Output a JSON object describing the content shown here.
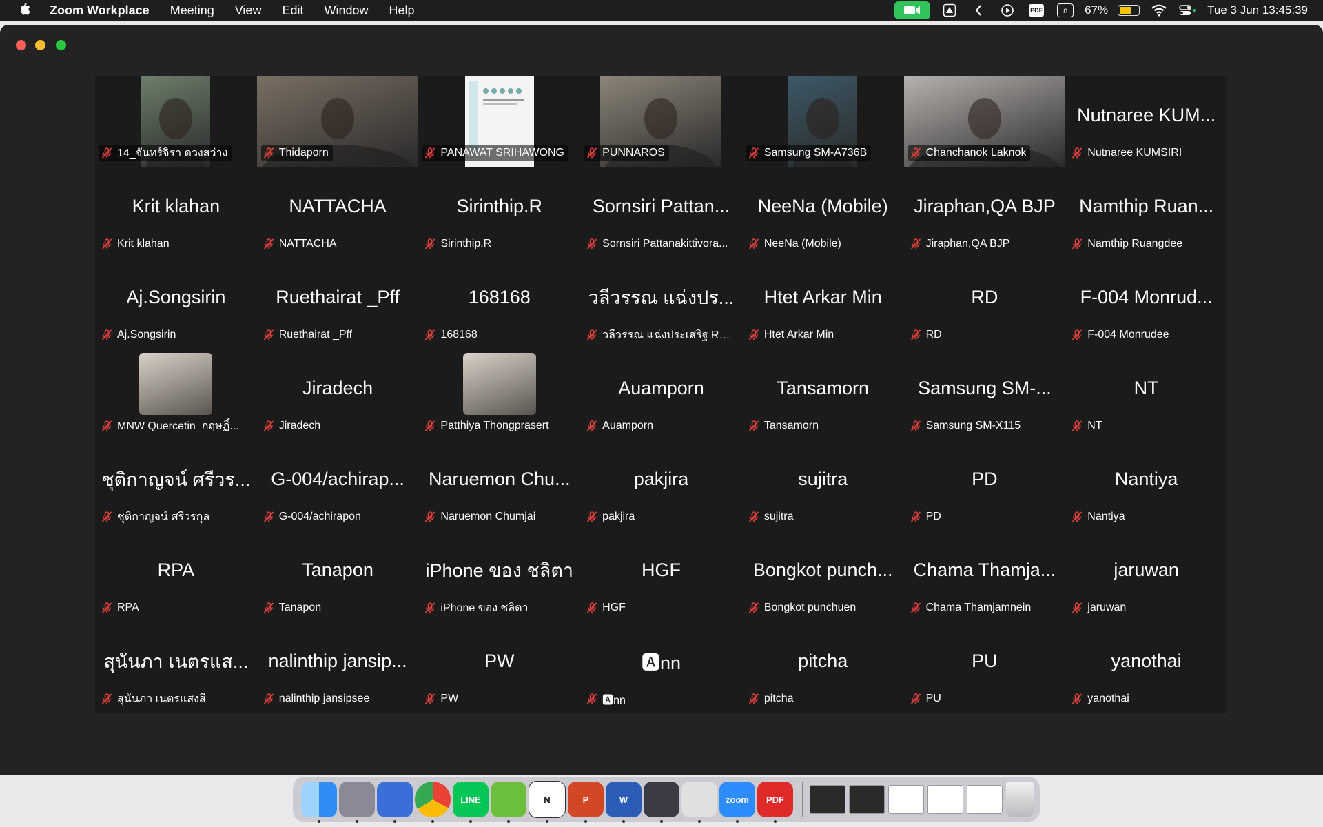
{
  "menubar": {
    "app_name": "Zoom Workplace",
    "menus": [
      "Meeting",
      "View",
      "Edit",
      "Window",
      "Help"
    ],
    "battery": "67%",
    "battery_level": 0.67,
    "datetime": "Tue 3 Jun  13:45:39",
    "status_icons": [
      "zoom-camera-icon",
      "drive-icon",
      "chevron-left-icon",
      "play-circle-icon",
      "pdf-icon",
      "thai-input-icon",
      "battery-icon",
      "wifi-icon",
      "control-center-icon"
    ]
  },
  "window": {
    "traffic_lights": {
      "close": "#ff5f57",
      "minimize": "#febc2e",
      "zoom": "#28c840"
    }
  },
  "participants": [
    {
      "display": "",
      "label": "14_จันทร์จิรา ดวงสว่าง",
      "video": "photo"
    },
    {
      "display": "",
      "label": "Thidaporn",
      "video": "photo"
    },
    {
      "display": "",
      "label": "PANAWAT SRIHAWONG",
      "video": "document"
    },
    {
      "display": "",
      "label": "PUNNAROS",
      "video": "photo"
    },
    {
      "display": "",
      "label": "Samsung SM-A736B",
      "video": "photo"
    },
    {
      "display": "",
      "label": "Chanchanok Laknok",
      "video": "photo"
    },
    {
      "display": "Nutnaree KUM...",
      "label": "Nutnaree KUMSIRI",
      "video": "none"
    },
    {
      "display": "Krit klahan",
      "label": "Krit klahan",
      "video": "none"
    },
    {
      "display": "NATTACHA",
      "label": "NATTACHA",
      "video": "none"
    },
    {
      "display": "Sirinthip.R",
      "label": "Sirinthip.R",
      "video": "none"
    },
    {
      "display": "Sornsiri Pattan...",
      "label": "Sornsiri Pattanakittivora...",
      "video": "none"
    },
    {
      "display": "NeeNa (Mobile)",
      "label": "NeeNa (Mobile)",
      "video": "none"
    },
    {
      "display": "Jiraphan,QA BJP",
      "label": "Jiraphan,QA BJP",
      "video": "none"
    },
    {
      "display": "Namthip Ruan...",
      "label": "Namthip Ruangdee",
      "video": "none"
    },
    {
      "display": "Aj.Songsirin",
      "label": "Aj.Songsirin",
      "video": "none"
    },
    {
      "display": "Ruethairat _Pff",
      "label": "Ruethairat _Pff",
      "video": "none"
    },
    {
      "display": "168168",
      "label": "168168",
      "video": "none"
    },
    {
      "display": "วลีวรรณ แฉ่งปร...",
      "label": "วลีวรรณ แฉ่งประเสริฐ RMU...",
      "video": "none"
    },
    {
      "display": "Htet Arkar Min",
      "label": "Htet Arkar Min",
      "video": "none"
    },
    {
      "display": "RD",
      "label": "RD",
      "video": "none"
    },
    {
      "display": "F-004 Monrud...",
      "label": "F-004 Monrudee",
      "video": "none"
    },
    {
      "display": "",
      "label": "MNW Quercetin_กฤษฏิ์...",
      "video": "avatar"
    },
    {
      "display": "Jiradech",
      "label": "Jiradech",
      "video": "none"
    },
    {
      "display": "",
      "label": "Patthiya Thongprasert",
      "video": "avatar"
    },
    {
      "display": "Auamporn",
      "label": "Auamporn",
      "video": "none"
    },
    {
      "display": "Tansamorn",
      "label": "Tansamorn",
      "video": "none"
    },
    {
      "display": "Samsung SM-...",
      "label": "Samsung SM-X115",
      "video": "none"
    },
    {
      "display": "NT",
      "label": "NT",
      "video": "none"
    },
    {
      "display": "ชุติกาญจน์ ศรีวร...",
      "label": "ชุติกาญจน์ ศรีวรกุล",
      "video": "none"
    },
    {
      "display": "G-004/achirap...",
      "label": "G-004/achirapon",
      "video": "none"
    },
    {
      "display": "Naruemon Chu...",
      "label": "Naruemon Chumjai",
      "video": "none"
    },
    {
      "display": "pakjira",
      "label": "pakjira",
      "video": "none"
    },
    {
      "display": "sujitra",
      "label": "sujitra",
      "video": "none"
    },
    {
      "display": "PD",
      "label": "PD",
      "video": "none"
    },
    {
      "display": "Nantiya",
      "label": "Nantiya",
      "video": "none"
    },
    {
      "display": "RPA",
      "label": "RPA",
      "video": "none"
    },
    {
      "display": "Tanapon",
      "label": "Tanapon",
      "video": "none"
    },
    {
      "display": "iPhone ของ ชลิตา",
      "label": "iPhone ของ ชลิตา",
      "video": "none"
    },
    {
      "display": "HGF",
      "label": "HGF",
      "video": "none"
    },
    {
      "display": "Bongkot punch...",
      "label": "Bongkot punchuen",
      "video": "none"
    },
    {
      "display": "Chama Thamja...",
      "label": "Chama Thamjamnein",
      "video": "none"
    },
    {
      "display": "jaruwan",
      "label": "jaruwan",
      "video": "none"
    },
    {
      "display": "สุนันภา เนตรแส...",
      "label": "สุนันภา เนตรแสงสี",
      "video": "none"
    },
    {
      "display": "nalinthip jansip...",
      "label": "nalinthip jansipsee",
      "video": "none"
    },
    {
      "display": "PW",
      "label": "PW",
      "video": "none"
    },
    {
      "display": "🅰nn",
      "label": "🅰nn",
      "video": "none"
    },
    {
      "display": "pitcha",
      "label": "pitcha",
      "video": "none"
    },
    {
      "display": "PU",
      "label": "PU",
      "video": "none"
    },
    {
      "display": "yanothai",
      "label": "yanothai",
      "video": "none"
    }
  ],
  "dock": {
    "apps": [
      {
        "name": "finder",
        "color": "#2f8df5",
        "text": ""
      },
      {
        "name": "launchpad",
        "color": "#8a8a96",
        "text": ""
      },
      {
        "name": "firefox",
        "color": "#3a6fd8",
        "text": ""
      },
      {
        "name": "chrome",
        "color": "#e7e7e7",
        "text": ""
      },
      {
        "name": "line",
        "color": "#06c755",
        "text": "LINE"
      },
      {
        "name": "pages",
        "color": "#6cbf3a",
        "text": ""
      },
      {
        "name": "notion",
        "color": "#ffffff",
        "text": "N"
      },
      {
        "name": "powerpoint",
        "color": "#d24726",
        "text": "P"
      },
      {
        "name": "word",
        "color": "#2b5cb8",
        "text": "W"
      },
      {
        "name": "quicktime",
        "color": "#3b3b45",
        "text": ""
      },
      {
        "name": "vlc",
        "color": "#e0e0e0",
        "text": ""
      },
      {
        "name": "zoom",
        "color": "#2d8cff",
        "text": "zoom"
      },
      {
        "name": "pdf-expert",
        "color": "#e02a2a",
        "text": "PDF"
      }
    ],
    "windows": 5
  }
}
